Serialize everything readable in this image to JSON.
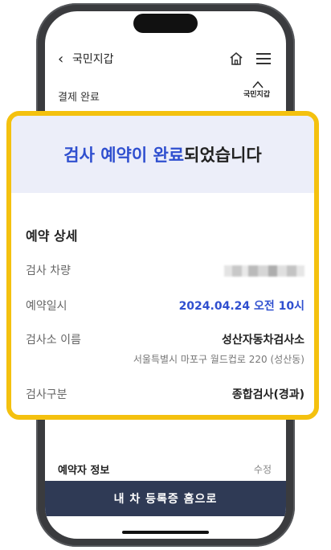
{
  "header": {
    "title": "국민지갑",
    "brand_mini": "국민지갑"
  },
  "subheader": {
    "label": "결제 완료"
  },
  "card": {
    "headline_highlight": "검사 예약이 완료",
    "headline_rest": "되었습니다",
    "section_title": "예약 상세",
    "rows": [
      {
        "label": "검사 차량",
        "value": ""
      },
      {
        "label": "예약일시",
        "value": "2024.04.24 오전 10시"
      },
      {
        "label": "검사소 이름",
        "value": "성산자동차검사소",
        "sub": "서울특별시 마포구 월드컵로 220 (성산동)"
      },
      {
        "label": "검사구분",
        "value": "종합검사(경과)"
      }
    ]
  },
  "booker": {
    "label": "예약자 정보",
    "edit": "수정"
  },
  "cta": {
    "label": "내 차 등록증 홈으로"
  },
  "colors": {
    "accent": "#2f4fcf",
    "highlight_border": "#f4c10f",
    "cta_bg": "#2f3a55",
    "head_bg": "#eceef9"
  },
  "icons": {
    "back": "chevron-left-icon",
    "home": "home-icon",
    "menu": "hamburger-icon"
  }
}
